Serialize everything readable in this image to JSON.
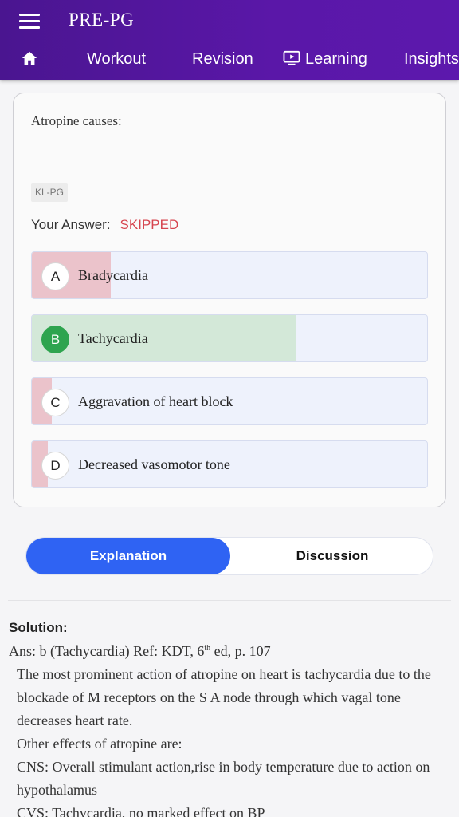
{
  "app": {
    "title": "PRE-PG"
  },
  "nav": {
    "home_icon": "home-icon",
    "items": [
      {
        "label": "Workout"
      },
      {
        "label": "Revision"
      },
      {
        "label": "Learning",
        "icon": "tv-play-icon"
      },
      {
        "label": "Insights"
      }
    ]
  },
  "question": {
    "text": "Atropine causes:",
    "tag": "KL-PG",
    "your_answer_label": "Your Answer:",
    "your_answer_status": "SKIPPED",
    "options": [
      {
        "letter": "A",
        "text": "Bradycardia",
        "response_share": 0.2,
        "fill_color": "#ebc3cb",
        "correct": false
      },
      {
        "letter": "B",
        "text": "Tachycardia",
        "response_share": 0.67,
        "fill_color": "#d3e8d8",
        "correct": true
      },
      {
        "letter": "C",
        "text": "Aggravation of heart block",
        "response_share": 0.05,
        "fill_color": "#ebc3cb",
        "correct": false
      },
      {
        "letter": "D",
        "text": "Decreased vasomotor tone",
        "response_share": 0.04,
        "fill_color": "#ebc3cb",
        "correct": false
      }
    ]
  },
  "tabs": {
    "explanation": "Explanation",
    "discussion": "Discussion",
    "active": "Explanation"
  },
  "solution": {
    "heading": "Solution:",
    "ans_prefix": "Ans: b (Tachycardia) Ref: KDT, 6",
    "ans_sup": "th",
    "ans_suffix": " ed, p. 107",
    "p1": "The most prominent action of atropine on heart is tachycardia due to the blockade of M receptors on the S A node through which vagal tone decreases heart rate.",
    "p2": "Other effects of atropine are:",
    "p3": "CNS: Overall stimulant action,rise in body temperature due to action on hypothalamus",
    "p4": "CVS: Tachycardia, no marked effect on BP"
  },
  "colors": {
    "header": "#5a17a8",
    "accent": "#2f63f3",
    "skipped": "#d6454f",
    "correct": "#2ea44f"
  }
}
